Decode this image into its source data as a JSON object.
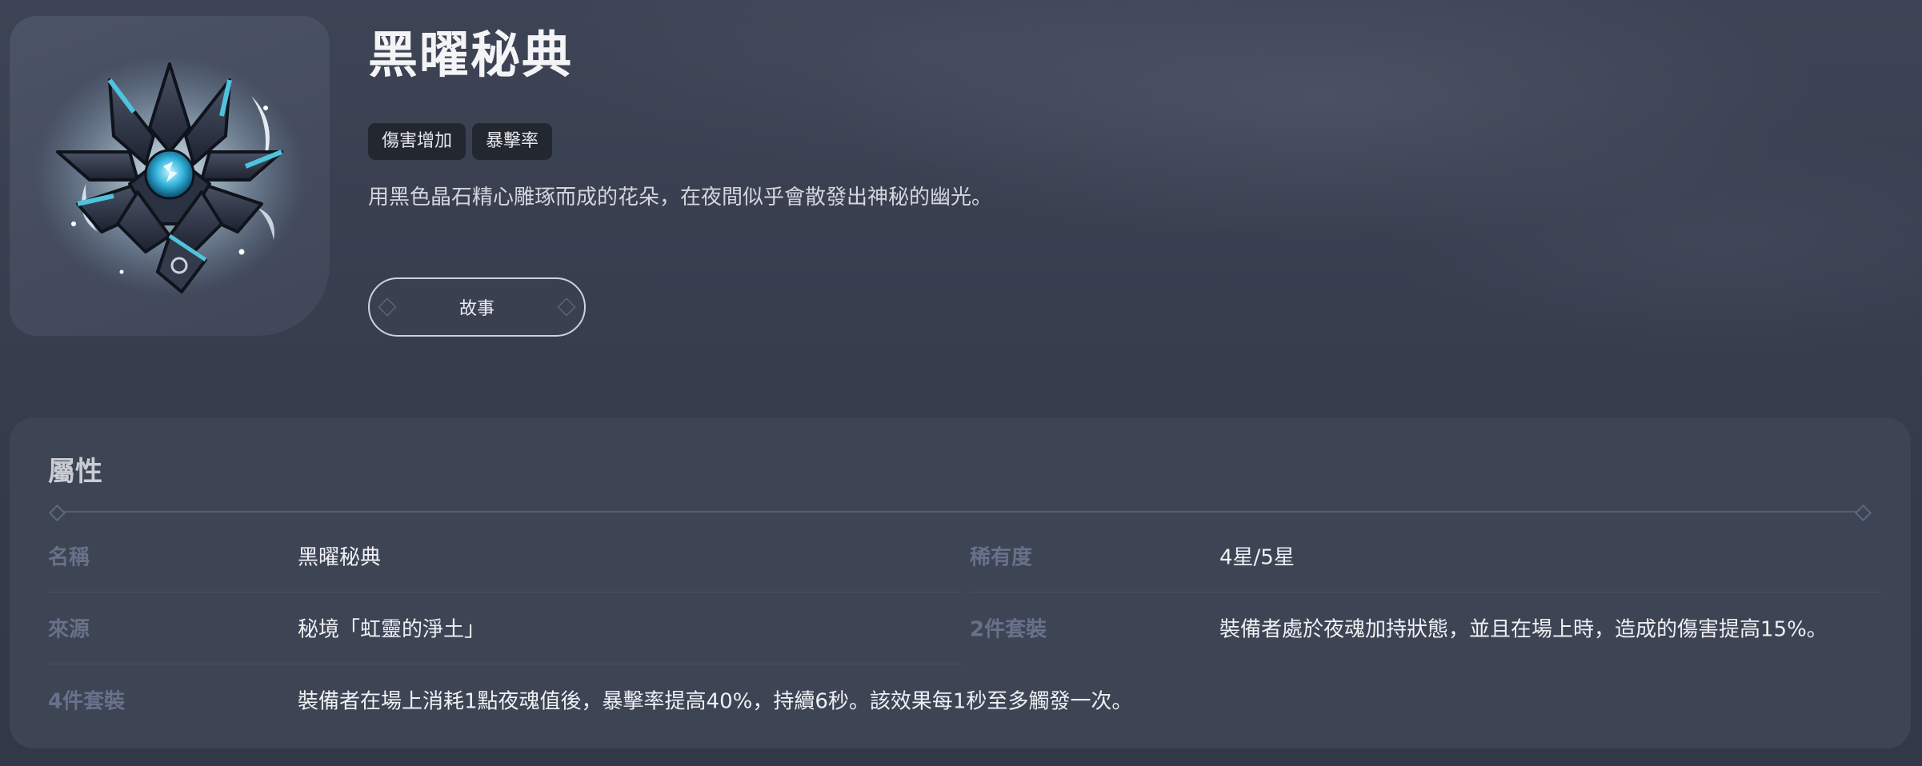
{
  "header": {
    "title": "黑曜秘典",
    "tags": [
      "傷害增加",
      "暴擊率"
    ],
    "description": "用黑色晶石精心雕琢而成的花朵，在夜間似乎會散發出神秘的幽光。",
    "story_button": "故事",
    "icon": "obsidian-lotus-artifact-icon"
  },
  "attributes": {
    "title": "屬性",
    "rows": [
      {
        "label": "名稱",
        "value": "黑曜秘典"
      },
      {
        "label": "稀有度",
        "value": "4星/5星"
      },
      {
        "label": "來源",
        "value": "秘境「虹靈的淨土」"
      },
      {
        "label": "2件套裝",
        "value": "裝備者處於夜魂加持狀態，並且在場上時，造成的傷害提高15%。"
      },
      {
        "label": "4件套裝",
        "value": "裝備者在場上消耗1點夜魂值後，暴擊率提高40%，持續6秒。該效果每1秒至多觸發一次。"
      }
    ]
  },
  "colors": {
    "background": "#363c4d",
    "panel": "#3d4454",
    "tag_bg": "#23272f",
    "label": "#68718a",
    "accent_cyan": "#4ec3e0"
  }
}
